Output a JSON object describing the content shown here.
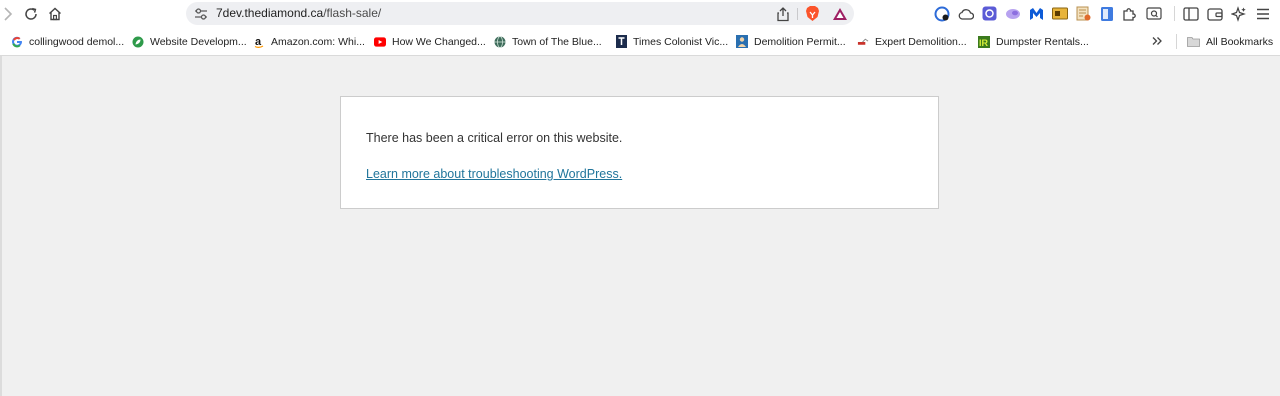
{
  "browser": {
    "url_host": "7dev.thediamond.ca",
    "url_path": "/flash-sale/",
    "nav_icons": [
      "forward-icon",
      "reload-icon",
      "home-icon"
    ],
    "url_icons": [
      "site-settings-icon",
      "share-icon",
      "brave-shields-icon",
      "brave-rewards-icon"
    ],
    "extension_icons": [
      "extension-1-icon",
      "cloud-icon",
      "extension-3-icon",
      "extension-4-icon",
      "malwarebytes-icon",
      "extension-6-icon",
      "extension-7-icon",
      "extension-8-icon",
      "extensions-puzzle-icon",
      "screenshot-icon",
      "sidebar-icon",
      "wallet-icon",
      "leo-ai-icon",
      "menu-icon"
    ]
  },
  "bookmarks": {
    "items": [
      {
        "label": "collingwood demol...",
        "icon": "google-icon"
      },
      {
        "label": "Website Developm...",
        "icon": "leaf-icon"
      },
      {
        "label": "Amazon.com: Whi...",
        "icon": "amazon-icon"
      },
      {
        "label": "How We Changed...",
        "icon": "youtube-icon"
      },
      {
        "label": "Town of The Blue...",
        "icon": "globe-icon"
      },
      {
        "label": "Times Colonist Vic...",
        "icon": "times-colonist-icon"
      },
      {
        "label": "Demolition Permit...",
        "icon": "person-icon"
      },
      {
        "label": "Expert Demolition...",
        "icon": "excavator-icon"
      },
      {
        "label": "Dumpster Rentals...",
        "icon": "tr-logo-icon"
      }
    ],
    "all_bookmarks_label": "All Bookmarks"
  },
  "page": {
    "error_message": "There has been a critical error on this website.",
    "help_link": "Learn more about troubleshooting WordPress."
  },
  "colors": {
    "page_background": "#f0f0f0",
    "link": "#21759b",
    "box_border": "#cccccc"
  }
}
